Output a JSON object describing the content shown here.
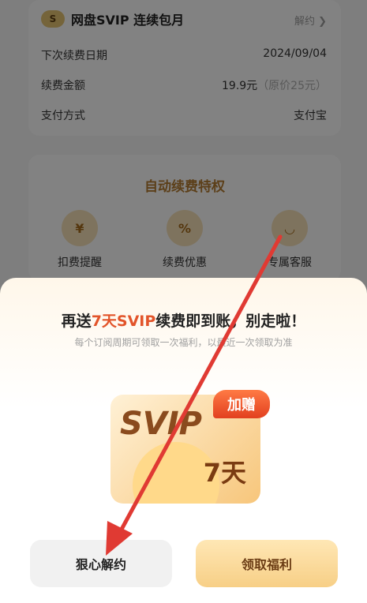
{
  "subscription": {
    "title": "网盘SVIP 连续包月",
    "cancel_link": "解约 ❯",
    "rows": [
      {
        "label": "下次续费日期",
        "value": "2024/09/04"
      },
      {
        "label": "续费金额",
        "value": "19.9元",
        "extra": "（原价25元）"
      },
      {
        "label": "支付方式",
        "value": "支付宝"
      }
    ]
  },
  "privileges": {
    "title": "自动续费特权",
    "items": [
      {
        "label": "扣费提醒",
        "icon": "yen-note-icon"
      },
      {
        "label": "续费优惠",
        "icon": "discount-icon"
      },
      {
        "label": "专属客服",
        "icon": "chat-bubble-icon"
      }
    ]
  },
  "modal": {
    "title_prefix": "再送",
    "title_highlight": "7天SVIP",
    "title_suffix": "续费即到账，别走啦！",
    "subtitle": "每个订阅周期可领取一次福利，以最近一次领取为准",
    "gift": {
      "brand": "SVIP",
      "days": "7天",
      "badge": "加赠"
    },
    "buttons": {
      "cancel": "狠心解约",
      "claim": "领取福利"
    }
  },
  "colors": {
    "accent": "#e2542a",
    "gold": "#b07a30",
    "annotation_arrow": "#e03a33"
  }
}
